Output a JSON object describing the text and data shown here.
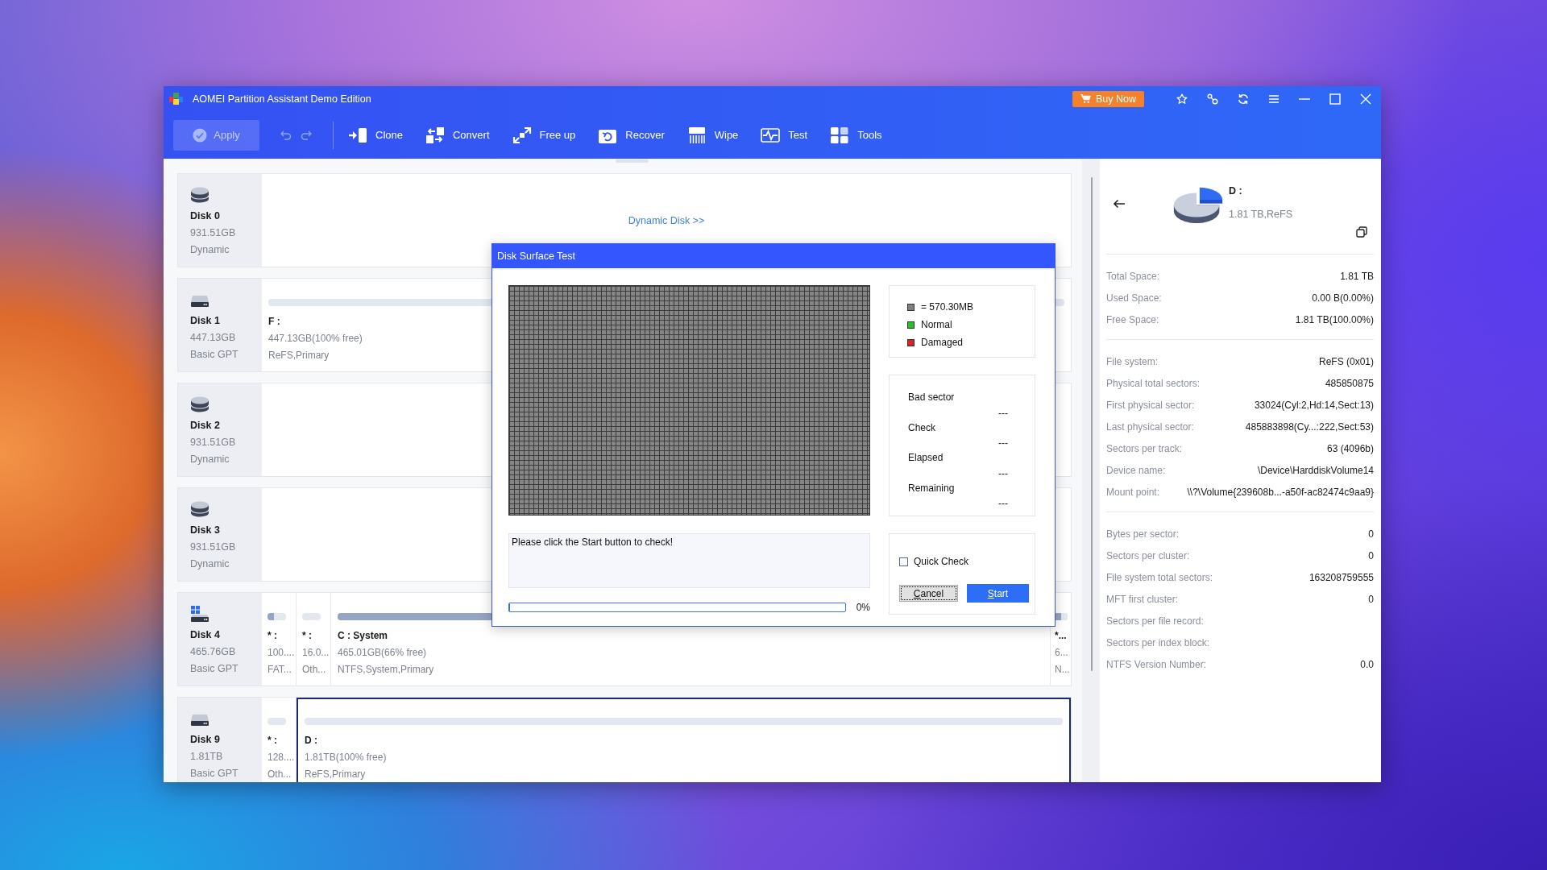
{
  "window": {
    "title": "AOMEI Partition Assistant Demo Edition",
    "buy_button": "Buy Now"
  },
  "toolbar": {
    "apply": {
      "label": "Apply",
      "disabled": true
    },
    "undo": {
      "disabled": true
    },
    "redo": {
      "disabled": true
    },
    "items": [
      {
        "label": "Clone"
      },
      {
        "label": "Convert"
      },
      {
        "label": "Free up"
      },
      {
        "label": "Recover"
      },
      {
        "label": "Wipe"
      },
      {
        "label": "Test"
      },
      {
        "label": "Tools"
      }
    ]
  },
  "disks": [
    {
      "kind": "dynamic",
      "name": "Disk 0",
      "size": "931.51GB",
      "type": "Dynamic",
      "link": "Dynamic Disk >>"
    },
    {
      "kind": "basic",
      "name": "Disk 1",
      "size": "447.13GB",
      "type": "Basic GPT",
      "partitions": [
        {
          "kind": "large",
          "letter": "F :",
          "size": "447.13GB(100% free)",
          "fs": "ReFS,Primary",
          "selected": false
        }
      ]
    },
    {
      "kind": "dynamic",
      "name": "Disk 2",
      "size": "931.51GB",
      "type": "Dynamic"
    },
    {
      "kind": "dynamic",
      "name": "Disk 3",
      "size": "931.51GB",
      "type": "Dynamic"
    },
    {
      "kind": "system",
      "name": "Disk 4",
      "size": "465.76GB",
      "type": "Basic GPT",
      "partitions": [
        {
          "kind": "small",
          "letter": "* :",
          "size": "100....",
          "fs": "FAT...",
          "level": 0.35,
          "selected": false
        },
        {
          "kind": "small",
          "letter": "* :",
          "size": "16.0...",
          "fs": "Oth...",
          "selected": false
        },
        {
          "kind": "large",
          "letter": "C : System",
          "size": "465.01GB(66% free)",
          "fs": "NTFS,System,Primary",
          "level": 0.34,
          "selected": false
        },
        {
          "kind": "narrow",
          "letter": "*...",
          "size": "6...",
          "fs": "N...",
          "level": 0.5,
          "selected": false
        }
      ]
    },
    {
      "kind": "basic",
      "name": "Disk 9",
      "size": "1.81TB",
      "type": "Basic GPT",
      "partitions": [
        {
          "kind": "small",
          "letter": "* :",
          "size": "128....",
          "fs": "Oth...",
          "selected": false
        },
        {
          "kind": "large",
          "letter": "D :",
          "size": "1.81TB(100% free)",
          "fs": "ReFS,Primary",
          "selected": true
        }
      ]
    }
  ],
  "details": {
    "name": "D :",
    "summary": "1.81 TB,ReFS",
    "groups": [
      {
        "rows": [
          {
            "label": "Total Space:",
            "value": "1.81 TB"
          },
          {
            "label": "Used Space:",
            "value": "0.00 B(0.00%)"
          },
          {
            "label": "Free Space:",
            "value": "1.81 TB(100.00%)"
          }
        ]
      },
      {
        "rows": [
          {
            "label": "File system:",
            "value": "ReFS (0x01)"
          },
          {
            "label": "Physical total sectors:",
            "value": "485850875"
          },
          {
            "label": "First physical sector:",
            "value": "33024(Cyl:2,Hd:14,Sect:13)"
          },
          {
            "label": "Last physical sector:",
            "value": "485883898(Cy...:222,Sect:53)"
          },
          {
            "label": "Sectors per track:",
            "value": "63 (4096b)"
          },
          {
            "label": "Device name:",
            "value": "\\Device\\HarddiskVolume14"
          },
          {
            "label": "Mount point:",
            "value": "\\\\?\\Volume{239608b...-a50f-ac82474c9aa9}"
          }
        ]
      },
      {
        "rows": [
          {
            "label": "Bytes per sector:",
            "value": "0"
          },
          {
            "label": "Sectors per cluster:",
            "value": "0"
          },
          {
            "label": "File system total sectors:",
            "value": "163208759555"
          },
          {
            "label": "MFT first cluster:",
            "value": "0"
          },
          {
            "label": "Sectors per file record:"
          },
          {
            "label": "Sectors per index block:"
          },
          {
            "label": "NTFS Version Number:",
            "value": "0.0"
          }
        ]
      }
    ]
  },
  "dialog": {
    "title": "Disk Surface Test",
    "legend": [
      {
        "label": "= 570.30MB",
        "color": "#808080"
      },
      {
        "label": "Normal",
        "color": "#22c322"
      },
      {
        "label": "Damaged",
        "color": "#e02020"
      }
    ],
    "stats": [
      {
        "label": "Bad sector",
        "value": "---"
      },
      {
        "label": "Check",
        "value": "---"
      },
      {
        "label": "Elapsed",
        "value": "---"
      },
      {
        "label": "Remaining",
        "value": "---"
      }
    ],
    "message": "Please click the Start button to check!",
    "progress": {
      "level": 0,
      "reading": "0%"
    },
    "quick_check": {
      "label": "Quick Check",
      "checked": false
    },
    "buttons": [
      {
        "label": "Cancel",
        "kind": "secondary",
        "focused": true
      },
      {
        "label": "Start",
        "kind": "primary",
        "focused": false
      }
    ]
  }
}
